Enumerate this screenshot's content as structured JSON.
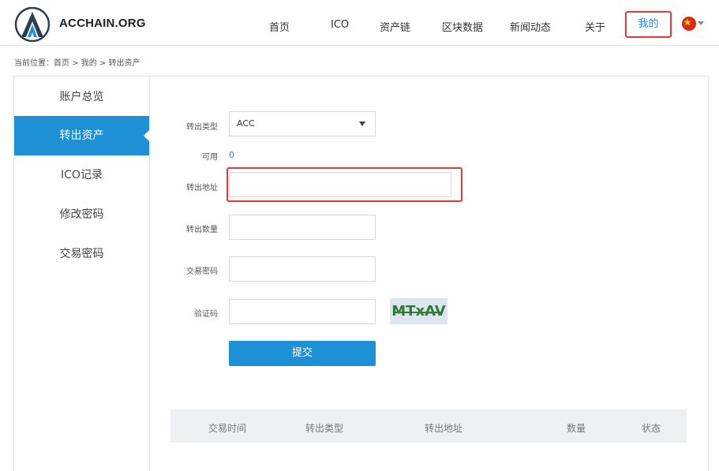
{
  "header": {
    "brand": "ACCHAIN.ORG",
    "nav": [
      "首页",
      "ICO",
      "资产链",
      "区块数据",
      "新闻动态",
      "关于"
    ],
    "nav_active": "我的",
    "language_flag": "china-flag-icon"
  },
  "breadcrumb": "当前位置：首页 > 我的 > 转出资产",
  "sidebar": {
    "items": [
      {
        "label": "账户总览",
        "active": false
      },
      {
        "label": "转出资产",
        "active": true
      },
      {
        "label": "ICO记录",
        "active": false
      },
      {
        "label": "修改密码",
        "active": false
      },
      {
        "label": "交易密码",
        "active": false
      }
    ]
  },
  "form": {
    "type_label": "转出类型",
    "type_value": "ACC",
    "available_label": "可用",
    "available_value": "0",
    "address_label": "转出地址",
    "address_value": "",
    "amount_label": "转出数量",
    "amount_value": "",
    "password_label": "交易密码",
    "password_value": "",
    "captcha_label": "验证码",
    "captcha_value": "",
    "captcha_image_text": "MTxAV",
    "submit_label": "提交"
  },
  "table": {
    "headers": [
      "交易时间",
      "转出类型",
      "转出地址",
      "数量",
      "状态"
    ]
  },
  "colors": {
    "accent": "#1e90d6",
    "highlight": "#e53935",
    "captcha_text": "#2e7d32"
  }
}
